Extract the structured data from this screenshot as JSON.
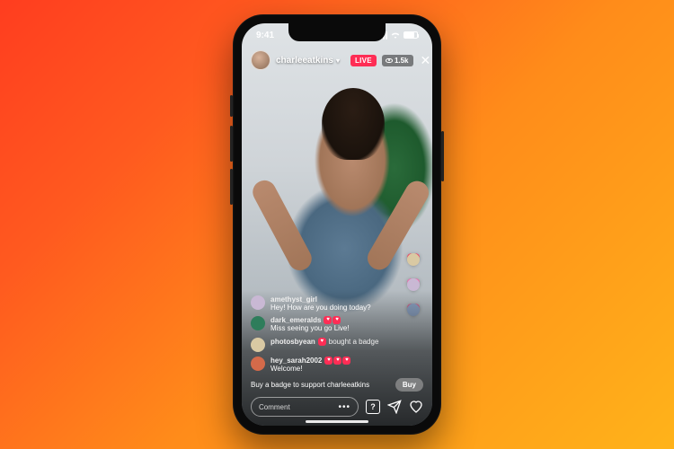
{
  "status": {
    "time": "9:41"
  },
  "header": {
    "username": "charleeatkins",
    "live_label": "LIVE",
    "viewer_count": "1.5k"
  },
  "comments": [
    {
      "user": "amethyst_girl",
      "text": "Hey! How are you doing today?",
      "avatar_color": "#c9b8d4",
      "badges": []
    },
    {
      "user": "dark_emeralds",
      "text": "Miss seeing you go Live!",
      "avatar_color": "#2e7d5b",
      "badges": [
        "#ff2d55",
        "#ff2d55"
      ]
    },
    {
      "user": "photosbyean",
      "text": "bought a badge",
      "avatar_color": "#d9c9a3",
      "badges": [
        "#ff2d55"
      ],
      "system": true
    },
    {
      "user": "hey_sarah2002",
      "text": "Welcome!",
      "avatar_color": "#d46a4a",
      "badges": [
        "#ff2d55",
        "#ff2d55",
        "#ff2d55"
      ]
    }
  ],
  "cta": {
    "text": "Buy a badge to support charleeatkins",
    "button": "Buy"
  },
  "input": {
    "placeholder": "Comment"
  },
  "floating_hearts": [
    {
      "color": "#ff2d55",
      "avatar": "#d9c9a3"
    },
    {
      "color": "#ff5aa8",
      "avatar": "#c9b8d4"
    },
    {
      "color": "#e84a7a",
      "avatar": "#8aa0c0"
    }
  ]
}
